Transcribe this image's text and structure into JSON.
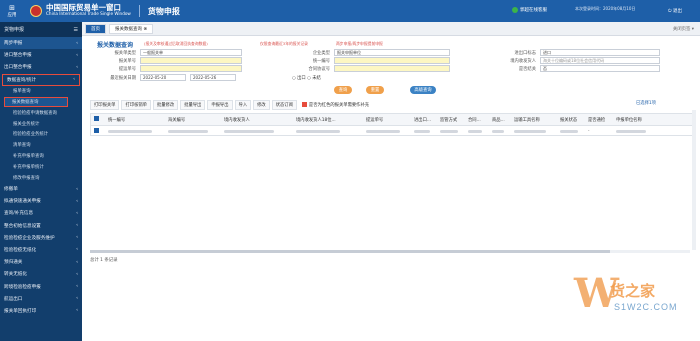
{
  "topbar": {
    "home_label": "应用",
    "brand_cn": "中国国际贸易单一窗口",
    "brand_en": "China International Trade Single Window",
    "app_title": "货物申报",
    "online_label": "郭超在线客服",
    "who_line1": "",
    "who_line2": "本次登录时间：2020年08月10日",
    "exit_label": "退出"
  },
  "sidebar": {
    "header": "货物申报",
    "items": [
      {
        "label": "两步申报",
        "chev": "‹"
      },
      {
        "label": "进口整合申报",
        "chev": "‹"
      },
      {
        "label": "出口整合申报",
        "chev": "‹"
      },
      {
        "label": "数据查询/统计",
        "chev": "‹"
      }
    ],
    "subitems": [
      "报单查询",
      "报关数据查询",
      "检验检疫申请数据查询",
      "报关业务统计",
      "检验检疫业务统计",
      "清单查询",
      "补充申报单查询",
      "补充申报单统计",
      "修改申报查询"
    ],
    "items2": [
      {
        "label": "修撤单",
        "chev": "‹"
      },
      {
        "label": "拟通快速通关申报",
        "chev": "‹"
      },
      {
        "label": "查询/补充信息",
        "chev": "‹"
      },
      {
        "label": "整合初始信息设置",
        "chev": "‹"
      },
      {
        "label": "检验检疫企业及服务维护",
        "chev": "‹"
      },
      {
        "label": "检验检疫无纸化",
        "chev": "‹"
      },
      {
        "label": "预归通关",
        "chev": "‹"
      },
      {
        "label": "转关无纸化",
        "chev": "‹"
      },
      {
        "label": "跨境检验检疫申报",
        "chev": "‹"
      },
      {
        "label": "航运出口",
        "chev": "‹"
      },
      {
        "label": "报关单回执打印",
        "chev": "‹"
      }
    ]
  },
  "tabs": {
    "items": [
      "首页",
      "报关数据查询 ⊗"
    ],
    "close_all": "关闭页签 ▾"
  },
  "form": {
    "title": "报关数据查询",
    "hint": "(报关及审核通过后取消回执查询数据)",
    "warn1": "仅限查询最近3年的报关记录",
    "warn2": "两步申报/两步申报提前申报",
    "fields": {
      "customs_type_label": "报关单类型",
      "customs_type_value": "一般报关单",
      "decl_no_label": "报关单号",
      "cert_no_label": "提运单号",
      "date_label": "最近报关日期",
      "date_from": "2022-05-20",
      "date_to": "2022-05-26",
      "ie_label": "企业类型",
      "ie_value": "报关申报单位",
      "unified_label": "统一编号",
      "contract_label": "合同协议号",
      "port_label": "进出口标志",
      "port_value": "进口",
      "domestic_label": "境内收发货人",
      "domestic_value": "海关十位编码或18位社会信用代码",
      "two_step_label": "是否结关",
      "two_step_value": "否",
      "radio_import": "出口",
      "radio_export": "未结"
    },
    "btn_query": "查询",
    "btn_reset": "重置",
    "btn_advanced": "高级查询"
  },
  "toolbar": {
    "buttons": [
      "打印报关单",
      "打印核销单",
      "批量修改",
      "批量导出",
      "申报导出",
      "导入",
      "修改",
      "状态订阅"
    ],
    "check_label": "是否为红色的报关单需要作补充",
    "page_info": "已选择1项"
  },
  "table": {
    "columns": [
      "统一编号",
      "海关编号",
      "境内收发货人",
      "境内收发货人18位...",
      "提运单号",
      "进出口...",
      "监管方式",
      "合同...",
      "商品...",
      "运输工具名称",
      "报关状态",
      "是否通检",
      "申报单位名称"
    ],
    "rows": [
      {
        "marker": "-",
        "status_cell": "-"
      }
    ],
    "summary": "总计 1 条记录"
  },
  "watermark": {
    "logo": "W",
    "cn": "货之家",
    "en": "S1W2C.COM"
  }
}
